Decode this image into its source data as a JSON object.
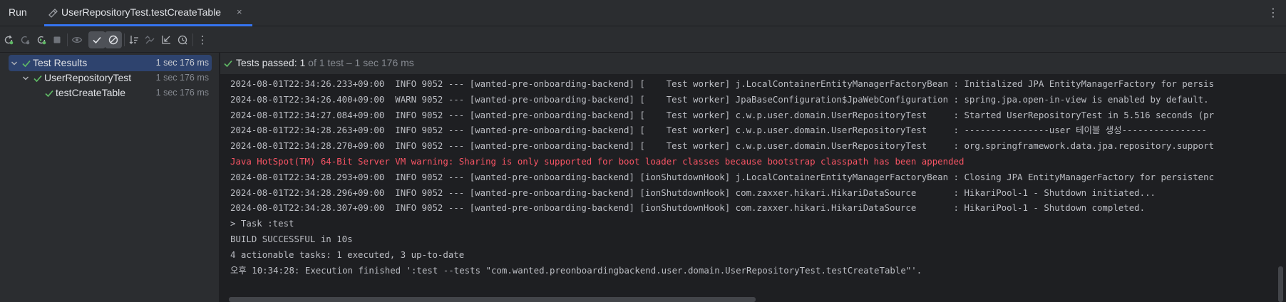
{
  "tabbar": {
    "run_label": "Run",
    "tab_title": "UserRepositoryTest.testCreateTable",
    "close_glyph": "×",
    "more_glyph": "⋮"
  },
  "toolbar": {
    "icons": [
      "rerun-icon",
      "rerun-failed-icon",
      "rerun-automatically-icon",
      "stop-icon",
      "toggle-preview-icon",
      "show-passed-icon",
      "show-ignored-icon",
      "sort-icon",
      "collapse-icon",
      "import-tests-icon",
      "history-icon",
      "more-icon"
    ],
    "more_glyph": "⋮"
  },
  "tree": {
    "items": [
      {
        "label": "Test Results",
        "time": "1 sec 176 ms",
        "level": 0,
        "selected": true
      },
      {
        "label": "UserRepositoryTest",
        "time": "1 sec 176 ms",
        "level": 1,
        "selected": false
      },
      {
        "label": "testCreateTable",
        "time": "1 sec 176 ms",
        "level": 2,
        "selected": false
      }
    ]
  },
  "status": {
    "main": "Tests passed: 1",
    "sub": " of 1 test – 1 sec 176 ms"
  },
  "log": {
    "lines": [
      {
        "text": "2024-08-01T22:34:26.233+09:00  INFO 9052 --- [wanted-pre-onboarding-backend] [    Test worker] j.LocalContainerEntityManagerFactoryBean : Initialized JPA EntityManagerFactory for persis",
        "type": "info"
      },
      {
        "text": "2024-08-01T22:34:26.400+09:00  WARN 9052 --- [wanted-pre-onboarding-backend] [    Test worker] JpaBaseConfiguration$JpaWebConfiguration : spring.jpa.open-in-view is enabled by default.",
        "type": "info"
      },
      {
        "text": "2024-08-01T22:34:27.084+09:00  INFO 9052 --- [wanted-pre-onboarding-backend] [    Test worker] c.w.p.user.domain.UserRepositoryTest     : Started UserRepositoryTest in 5.516 seconds (pr",
        "type": "info"
      },
      {
        "text": "2024-08-01T22:34:28.263+09:00  INFO 9052 --- [wanted-pre-onboarding-backend] [    Test worker] c.w.p.user.domain.UserRepositoryTest     : ----------------user 테이블 생성----------------",
        "type": "info"
      },
      {
        "text": "2024-08-01T22:34:28.270+09:00  INFO 9052 --- [wanted-pre-onboarding-backend] [    Test worker] c.w.p.user.domain.UserRepositoryTest     : org.springframework.data.jpa.repository.support",
        "type": "info"
      },
      {
        "text": "Java HotSpot(TM) 64-Bit Server VM warning: Sharing is only supported for boot loader classes because bootstrap classpath has been appended",
        "type": "warn"
      },
      {
        "text": "2024-08-01T22:34:28.293+09:00  INFO 9052 --- [wanted-pre-onboarding-backend] [ionShutdownHook] j.LocalContainerEntityManagerFactoryBean : Closing JPA EntityManagerFactory for persistenc",
        "type": "info"
      },
      {
        "text": "2024-08-01T22:34:28.296+09:00  INFO 9052 --- [wanted-pre-onboarding-backend] [ionShutdownHook] com.zaxxer.hikari.HikariDataSource       : HikariPool-1 - Shutdown initiated...",
        "type": "info"
      },
      {
        "text": "2024-08-01T22:34:28.307+09:00  INFO 9052 --- [wanted-pre-onboarding-backend] [ionShutdownHook] com.zaxxer.hikari.HikariDataSource       : HikariPool-1 - Shutdown completed.",
        "type": "info"
      },
      {
        "text": "> Task :test",
        "type": "info"
      },
      {
        "text": "BUILD SUCCESSFUL in 10s",
        "type": "info"
      },
      {
        "text": "4 actionable tasks: 1 executed, 3 up-to-date",
        "type": "info"
      },
      {
        "text": "오후 10:34:28: Execution finished ':test --tests \"com.wanted.preonboardingbackend.user.domain.UserRepositoryTest.testCreateTable\"'.",
        "type": "info"
      }
    ]
  },
  "colors": {
    "accent": "#3574f0",
    "pass_green": "#5fb865",
    "warn_red": "#f75464",
    "panel_bg": "#2b2d30",
    "console_bg": "#1e1f22"
  }
}
